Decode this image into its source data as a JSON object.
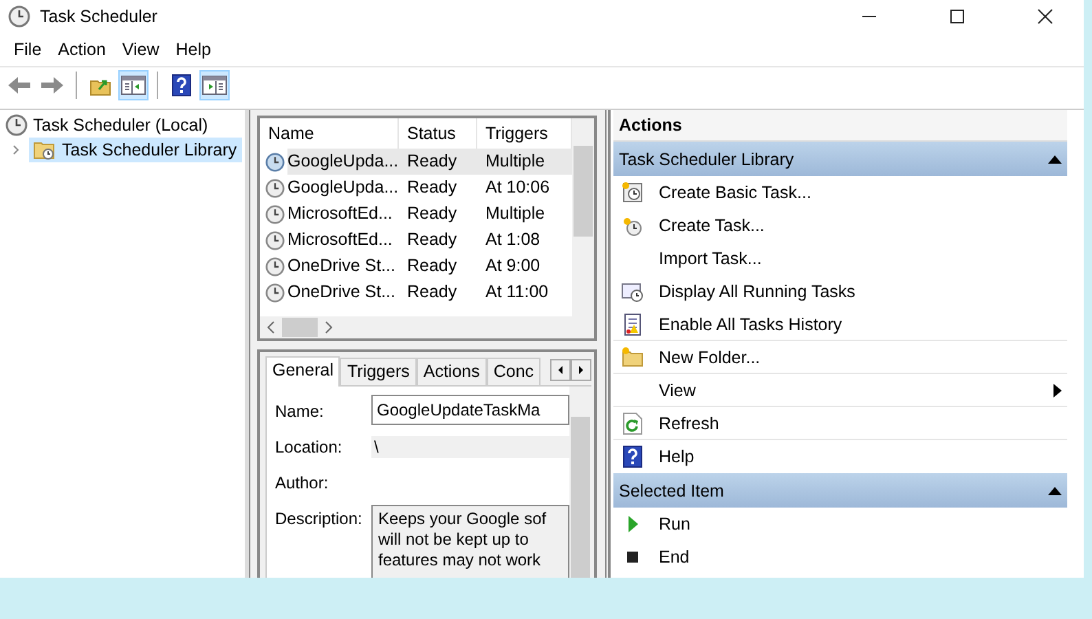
{
  "window": {
    "title": "Task Scheduler"
  },
  "menu": [
    "File",
    "Action",
    "View",
    "Help"
  ],
  "toolbar": [
    {
      "kind": "back",
      "pressed": false
    },
    {
      "kind": "forward",
      "pressed": false
    },
    {
      "kind": "sep"
    },
    {
      "kind": "upfolder",
      "pressed": false
    },
    {
      "kind": "tree",
      "pressed": true
    },
    {
      "kind": "sep"
    },
    {
      "kind": "help",
      "pressed": false
    },
    {
      "kind": "actionpane",
      "pressed": true
    }
  ],
  "tree": {
    "label": "Task Scheduler (Local)",
    "children": [
      {
        "label": "Task Scheduler Library",
        "selected": true,
        "expanded": false
      }
    ]
  },
  "task_list": {
    "columns": [
      "Name",
      "Status",
      "Triggers"
    ],
    "rows": [
      {
        "cells": [
          "GoogleUpda...",
          "Ready",
          "Multiple"
        ],
        "selected": true
      },
      {
        "cells": [
          "GoogleUpda...",
          "Ready",
          "At 10:06"
        ],
        "selected": false
      },
      {
        "cells": [
          "MicrosoftEd...",
          "Ready",
          "Multiple"
        ],
        "selected": false
      },
      {
        "cells": [
          "MicrosoftEd...",
          "Ready",
          "At 1:08"
        ],
        "selected": false
      },
      {
        "cells": [
          "OneDrive St...",
          "Ready",
          "At 9:00"
        ],
        "selected": false
      },
      {
        "cells": [
          "OneDrive St...",
          "Ready",
          "At 11:00"
        ],
        "selected": false
      }
    ]
  },
  "details": {
    "tabs": [
      {
        "label": "General",
        "selected": true
      },
      {
        "label": "Triggers",
        "selected": false
      },
      {
        "label": "Actions",
        "selected": false
      },
      {
        "label": "Conc",
        "selected": false
      }
    ],
    "fields": [
      {
        "label": "Name:",
        "kind": "input",
        "value": "GoogleUpdateTaskMa"
      },
      {
        "label": "Location:",
        "kind": "readonly",
        "value": "\\"
      },
      {
        "label": "Author:",
        "kind": "plain"
      },
      {
        "label": "Description:",
        "kind": "textarea",
        "lines": [
          "Keeps your Google sof",
          "will not be kept up to",
          "features may not work"
        ]
      }
    ]
  },
  "actions": {
    "title": "Actions",
    "sections": [
      {
        "title": "Task Scheduler Library",
        "expanded": true,
        "items": [
          {
            "label": "Create Basic Task...",
            "kind": "basictask",
            "divider": false
          },
          {
            "label": "Create Task...",
            "kind": "task",
            "divider": false
          },
          {
            "label": "Import Task...",
            "kind": "none",
            "divider": false
          },
          {
            "label": "Display All Running Tasks",
            "kind": "running",
            "divider": false
          },
          {
            "label": "Enable All Tasks History",
            "kind": "history",
            "divider": true
          },
          {
            "label": "New Folder...",
            "kind": "folder",
            "divider": true
          },
          {
            "label": "View",
            "kind": "submenu",
            "divider": true
          },
          {
            "label": "Refresh",
            "kind": "refresh",
            "divider": true
          },
          {
            "label": "Help",
            "kind": "help",
            "divider": false
          }
        ]
      },
      {
        "title": "Selected Item",
        "expanded": true,
        "items": [
          {
            "label": "Run",
            "kind": "run",
            "divider": false
          },
          {
            "label": "End",
            "kind": "end",
            "divider": false
          }
        ]
      }
    ]
  }
}
